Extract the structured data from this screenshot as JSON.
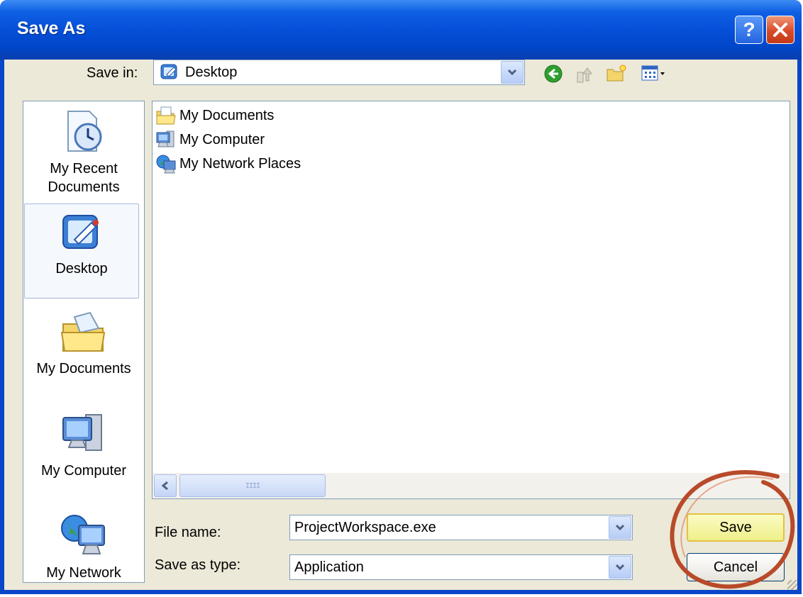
{
  "window": {
    "title": "Save As"
  },
  "titlebar": {
    "help_icon": "question-mark-icon",
    "close_icon": "close-x-icon"
  },
  "toolbar": {
    "save_in_label": "Save in:",
    "save_in_value": "Desktop",
    "icons": [
      "back-arrow-icon",
      "up-folder-icon",
      "new-folder-icon",
      "views-menu-icon"
    ]
  },
  "places": [
    {
      "label_line1": "My Recent",
      "label_line2": "Documents",
      "icon": "recent-documents-icon"
    },
    {
      "label_line1": "Desktop",
      "label_line2": "",
      "icon": "desktop-icon",
      "selected": true
    },
    {
      "label_line1": "My Documents",
      "label_line2": "",
      "icon": "my-documents-folder-icon"
    },
    {
      "label_line1": "My Computer",
      "label_line2": "",
      "icon": "my-computer-icon"
    },
    {
      "label_line1": "My Network",
      "label_line2": "",
      "icon": "my-network-icon"
    }
  ],
  "files": [
    {
      "name": "My Documents",
      "icon": "documents-folder-icon"
    },
    {
      "name": "My Computer",
      "icon": "computer-icon"
    },
    {
      "name": "My Network Places",
      "icon": "network-places-icon"
    }
  ],
  "scrollbar": {
    "grip": "IIII"
  },
  "form": {
    "file_name_label": "File name:",
    "file_name_value": "ProjectWorkspace.exe",
    "save_type_label": "Save as type:",
    "save_type_value": "Application"
  },
  "buttons": {
    "save": "Save",
    "cancel": "Cancel"
  },
  "colors": {
    "titlebar": "#0550d8",
    "dialog_bg": "#ece9d8",
    "highlight_circle": "#b84a2a",
    "save_button": "#f6f7a0"
  }
}
